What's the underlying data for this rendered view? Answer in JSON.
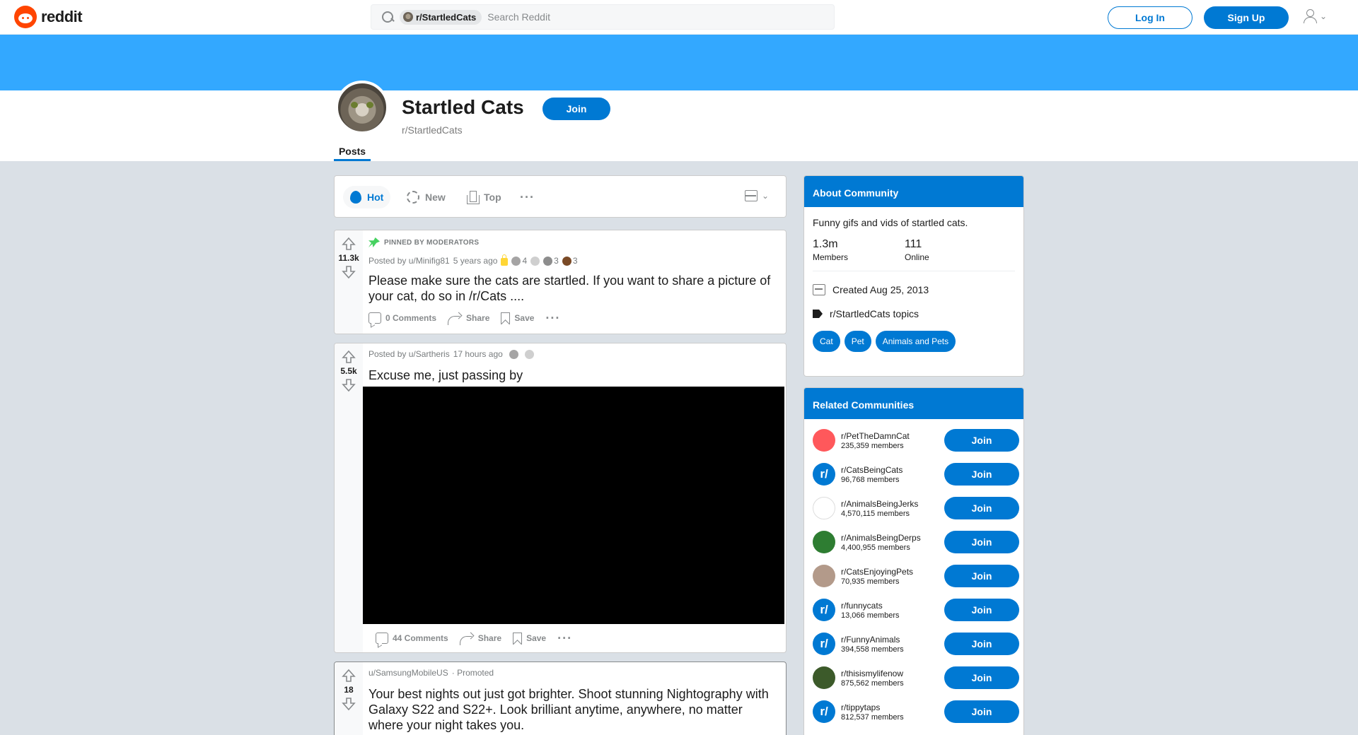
{
  "topbar": {
    "logo_text": "reddit",
    "search_chip": "r/StartledCats",
    "search_placeholder": "Search Reddit",
    "login_label": "Log In",
    "signup_label": "Sign Up"
  },
  "community": {
    "title": "Startled Cats",
    "name": "r/StartledCats",
    "join_label": "Join",
    "tab": "Posts",
    "banner_color": "#33a8ff"
  },
  "sort": {
    "hot": "Hot",
    "new": "New",
    "top": "Top"
  },
  "posts": [
    {
      "pinned_label": "PINNED BY MODERATORS",
      "score": "11.3k",
      "posted_by": "Posted by u/Minifig81",
      "age": "5 years ago",
      "awards": [
        "4",
        "3",
        "3"
      ],
      "title": "Please make sure the cats are startled. If you want to share a picture of your cat, do so in /r/Cats ....",
      "comments": "0 Comments",
      "share": "Share",
      "save": "Save"
    },
    {
      "score": "5.5k",
      "posted_by": "Posted by u/Sartheris",
      "age": "17 hours ago",
      "title": "Excuse me, just passing by",
      "comments": "44 Comments",
      "share": "Share",
      "save": "Save"
    },
    {
      "score": "18",
      "posted_by": "u/SamsungMobileUS",
      "promoted": "· Promoted",
      "title": "Your best nights out just got brighter. Shoot stunning Nightography with Galaxy S22 and S22+. Look brilliant anytime, anywhere, no matter where your night takes you."
    }
  ],
  "about": {
    "header": "About Community",
    "description": "Funny gifs and vids of startled cats.",
    "members_num": "1.3m",
    "members_label": "Members",
    "online_num": "111",
    "online_label": "Online",
    "created": "Created Aug 25, 2013",
    "topics": "r/StartledCats topics",
    "tags": [
      "Cat",
      "Pet",
      "Animals and Pets"
    ]
  },
  "related": {
    "header": "Related Communities",
    "join_label": "Join",
    "items": [
      {
        "name": "r/PetTheDamnCat",
        "members": "235,359 members",
        "color": "#ff585b"
      },
      {
        "name": "r/CatsBeingCats",
        "members": "96,768 members",
        "color": "#0079d3"
      },
      {
        "name": "r/AnimalsBeingJerks",
        "members": "4,570,115 members",
        "color": "#ffffff"
      },
      {
        "name": "r/AnimalsBeingDerps",
        "members": "4,400,955 members",
        "color": "#2e7d32"
      },
      {
        "name": "r/CatsEnjoyingPets",
        "members": "70,935 members",
        "color": "#b39a8a"
      },
      {
        "name": "r/funnycats",
        "members": "13,066 members",
        "color": "#0079d3"
      },
      {
        "name": "r/FunnyAnimals",
        "members": "394,558 members",
        "color": "#0079d3"
      },
      {
        "name": "r/thisismylifenow",
        "members": "875,562 members",
        "color": "#3c5a2a"
      },
      {
        "name": "r/tippytaps",
        "members": "812,537 members",
        "color": "#0079d3"
      }
    ]
  }
}
